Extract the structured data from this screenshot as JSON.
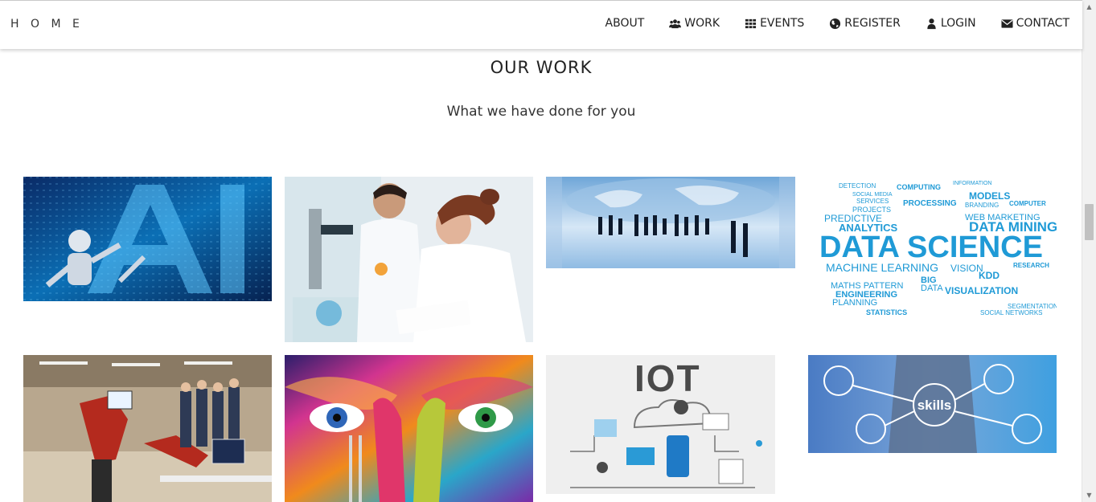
{
  "header": {
    "brand": "H O M E",
    "nav": [
      {
        "label": "ABOUT",
        "icon": ""
      },
      {
        "label": "WORK",
        "icon": "users-icon"
      },
      {
        "label": "EVENTS",
        "icon": "grid-icon"
      },
      {
        "label": "REGISTER",
        "icon": "globe-icon"
      },
      {
        "label": "LOGIN",
        "icon": "user-icon"
      },
      {
        "label": "CONTACT",
        "icon": "envelope-icon"
      }
    ]
  },
  "section": {
    "title": "OUR WORK",
    "subtitle": "What we have done for you"
  },
  "gallery": {
    "tiles": [
      {
        "name": "ai-robot-image",
        "overlay_text": "AI"
      },
      {
        "name": "lab-scientists-image",
        "overlay_text": ""
      },
      {
        "name": "business-world-image",
        "overlay_text": ""
      },
      {
        "name": "data-science-wordcloud-image",
        "overlay_text": "DATA SCIENCE"
      },
      {
        "name": "robotics-lab-image",
        "overlay_text": ""
      },
      {
        "name": "colorful-face-image",
        "overlay_text": ""
      },
      {
        "name": "iot-illustration-image",
        "overlay_text": "IOT"
      },
      {
        "name": "skills-image",
        "overlay_text": "skills"
      }
    ],
    "wordcloud_words": [
      "DETECTION",
      "COMPUTING",
      "INFORMATION",
      "SOCIAL MEDIA",
      "MODELS",
      "SERVICES",
      "PROCESSING",
      "COMPUTER",
      "PROJECTS",
      "BRANDING",
      "PREDICTIVE",
      "WEB MARKETING",
      "ANALYTICS",
      "DATA MINING",
      "MACHINE LEARNING",
      "VISION",
      "RESEARCH",
      "KDD",
      "MATHS PATTERN",
      "BIG DATA",
      "VISUALIZATION",
      "ENGINEERING",
      "PLANNING",
      "SEGMENTATION",
      "STATISTICS",
      "SOCIAL NETWORKS"
    ]
  },
  "colors": {
    "text": "#222222",
    "ai_blue": "#0b6fb5",
    "wordcloud_blue": "#1f9ad6",
    "iot_text": "#4a4a4a"
  }
}
